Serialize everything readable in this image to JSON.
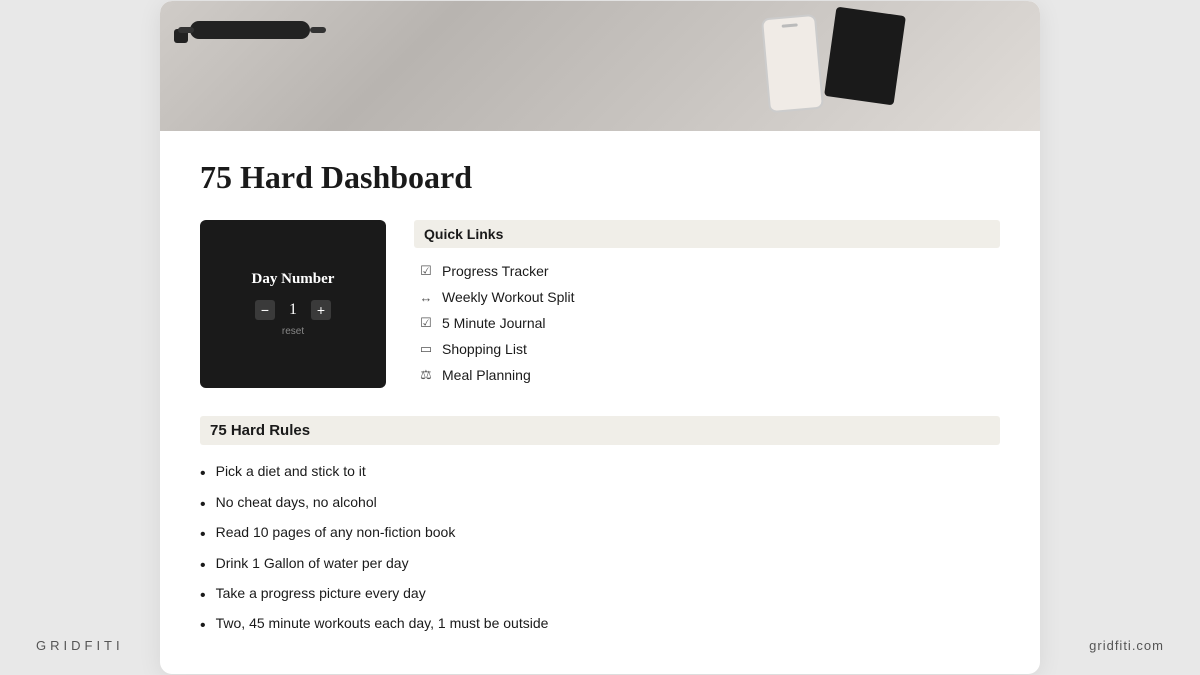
{
  "branding": {
    "left": "GRIDFITI",
    "right": "gridfiti.com"
  },
  "page": {
    "title": "75 Hard Dashboard"
  },
  "day_counter": {
    "label": "Day Number",
    "value": "1",
    "minus_label": "−",
    "plus_label": "+",
    "reset_label": "reset"
  },
  "quick_links": {
    "header": "Quick Links",
    "items": [
      {
        "icon": "☑",
        "label": "Progress Tracker"
      },
      {
        "icon": "↔",
        "label": "Weekly Workout Split"
      },
      {
        "icon": "☑",
        "label": "5 Minute Journal"
      },
      {
        "icon": "▭",
        "label": "Shopping List"
      },
      {
        "icon": "⚖",
        "label": "Meal Planning"
      }
    ]
  },
  "rules": {
    "header": "75 Hard Rules",
    "items": [
      "Pick a diet and stick to it",
      "No cheat days, no alcohol",
      "Read 10 pages of any non-fiction book",
      "Drink 1 Gallon of water per day",
      "Take a progress picture every day",
      "Two, 45 minute workouts each day, 1 must be outside"
    ]
  }
}
